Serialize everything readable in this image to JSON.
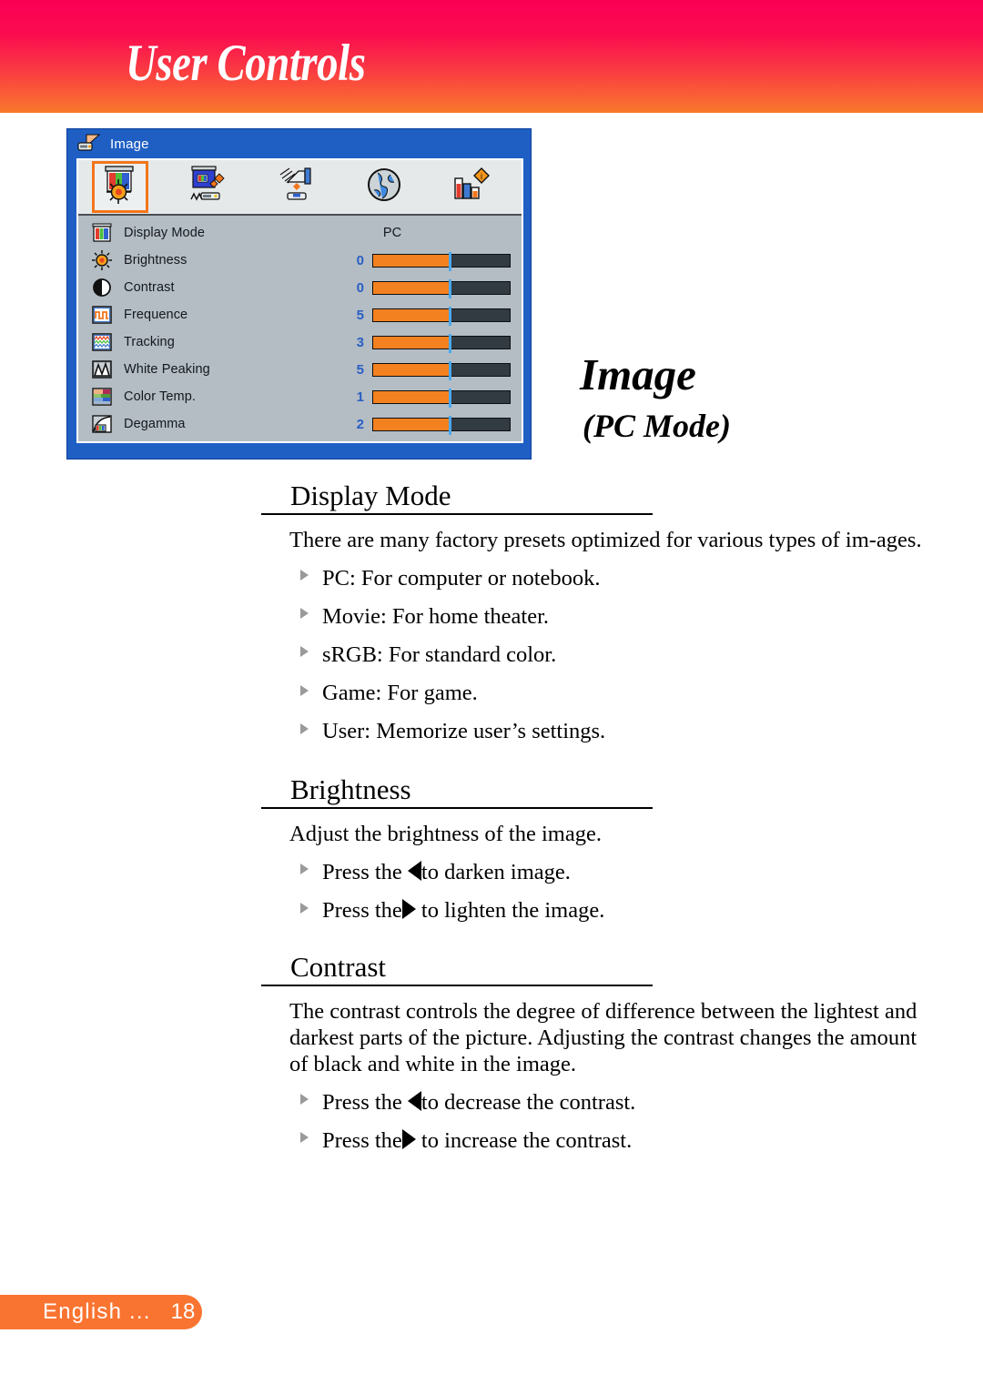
{
  "header": {
    "title": "User Controls",
    "gradient_top": "#fb0055",
    "gradient_bottom": "#f97a2c"
  },
  "osd": {
    "window_title": "Image",
    "titlebar_icon": "projector-icon",
    "accent_color": "#f3761b",
    "frame_color": "#1f5fc4",
    "panel_color": "#b4bdc4",
    "toolbar": [
      {
        "name": "image-tab",
        "icon": "image-screen-sun-icon",
        "selected": true
      },
      {
        "name": "computer-tab",
        "icon": "screen-projector-icon",
        "selected": false
      },
      {
        "name": "setup-tab",
        "icon": "hand-pointer-icon",
        "selected": false
      },
      {
        "name": "language-tab",
        "icon": "globe-icon",
        "selected": false
      },
      {
        "name": "options-tab",
        "icon": "bar-chart-info-icon",
        "selected": false
      }
    ],
    "rows": [
      {
        "icon": "rgb-bars-icon",
        "label": "Display Mode",
        "value_text": "PC",
        "type": "text"
      },
      {
        "icon": "sun-icon",
        "label": "Brightness",
        "value": "0",
        "fill_pct": 55,
        "type": "slider"
      },
      {
        "icon": "contrast-icon",
        "label": "Contrast",
        "value": "0",
        "fill_pct": 55,
        "type": "slider"
      },
      {
        "icon": "square-wave-icon",
        "label": "Frequence",
        "value": "5",
        "fill_pct": 55,
        "type": "slider"
      },
      {
        "icon": "waveform-icon",
        "label": "Tracking",
        "value": "3",
        "fill_pct": 55,
        "type": "slider"
      },
      {
        "icon": "peak-curve-icon",
        "label": "White Peaking",
        "value": "5",
        "fill_pct": 55,
        "type": "slider"
      },
      {
        "icon": "color-temp-icon",
        "label": "Color Temp.",
        "value": "1",
        "fill_pct": 55,
        "type": "slider"
      },
      {
        "icon": "gamma-curve-icon",
        "label": "Degamma",
        "value": "2",
        "fill_pct": 55,
        "type": "slider"
      }
    ]
  },
  "page_title": {
    "main": "Image",
    "sub": "(PC Mode)"
  },
  "sections": {
    "display_mode": {
      "heading": "Display Mode",
      "paragraph": "There are many factory presets optimized for various types of im-ages.",
      "bullets": [
        "PC: For computer or notebook.",
        "Movie: For home theater.",
        "sRGB: For standard color.",
        "Game: For game.",
        "User: Memorize user’s settings."
      ]
    },
    "brightness": {
      "heading": "Brightness",
      "paragraph": "Adjust the brightness of the image.",
      "bullet_left_pre": "Press the ",
      "bullet_left_post": "to darken image.",
      "bullet_right_pre": "Press the",
      "bullet_right_post": " to lighten the image."
    },
    "contrast": {
      "heading": "Contrast",
      "paragraph": "The contrast controls the degree of difference between the lightest and darkest parts of the picture. Adjusting the contrast changes the amount of black and white in the image.",
      "bullet_left_pre": "Press the ",
      "bullet_left_post": "to decrease the contrast.",
      "bullet_right_pre": "Press the",
      "bullet_right_post": " to increase the contrast."
    }
  },
  "footer": {
    "language": "English ...",
    "page_number": "18",
    "pill_color": "#f97431"
  }
}
